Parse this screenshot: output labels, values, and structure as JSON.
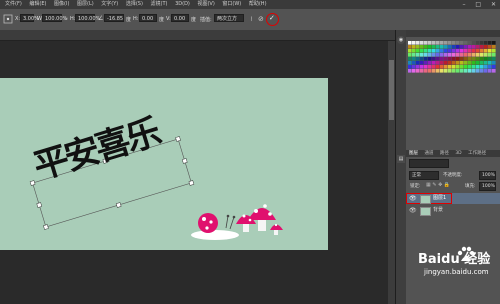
{
  "menu": {
    "items": [
      "文件(F)",
      "编辑(E)",
      "图像(I)",
      "图层(L)",
      "文字(Y)",
      "选择(S)",
      "滤镜(T)",
      "3D(D)",
      "视图(V)",
      "窗口(W)",
      "帮助(H)"
    ]
  },
  "options": {
    "x_value": "3.00%",
    "w_value": "100.00%",
    "h_value": "100.00%",
    "angle_value": "-16.85",
    "hskew_value": "0.00",
    "vskew_value": "0.00",
    "interp_label": "插值:",
    "interp_value": "两次立方"
  },
  "layers_panel": {
    "tabs": [
      "图层",
      "通道",
      "路径",
      "3D",
      "工作路径"
    ],
    "blend_mode": "正常",
    "opacity_label": "不透明度:",
    "opacity_value": "100%",
    "lock_label": "锁定:",
    "fill_label": "填充:",
    "fill_value": "100%",
    "layers": [
      {
        "name": "图层1"
      },
      {
        "name": "背景"
      }
    ]
  },
  "canvas": {
    "text": "平安喜乐"
  },
  "watermark": {
    "brand": "Baidu 经验",
    "url": "jingyan.baidu.com"
  },
  "colors": {
    "canvas_bg": "#a9cdb8",
    "highlight": "#e00000",
    "mushroom": "#e0106e"
  }
}
